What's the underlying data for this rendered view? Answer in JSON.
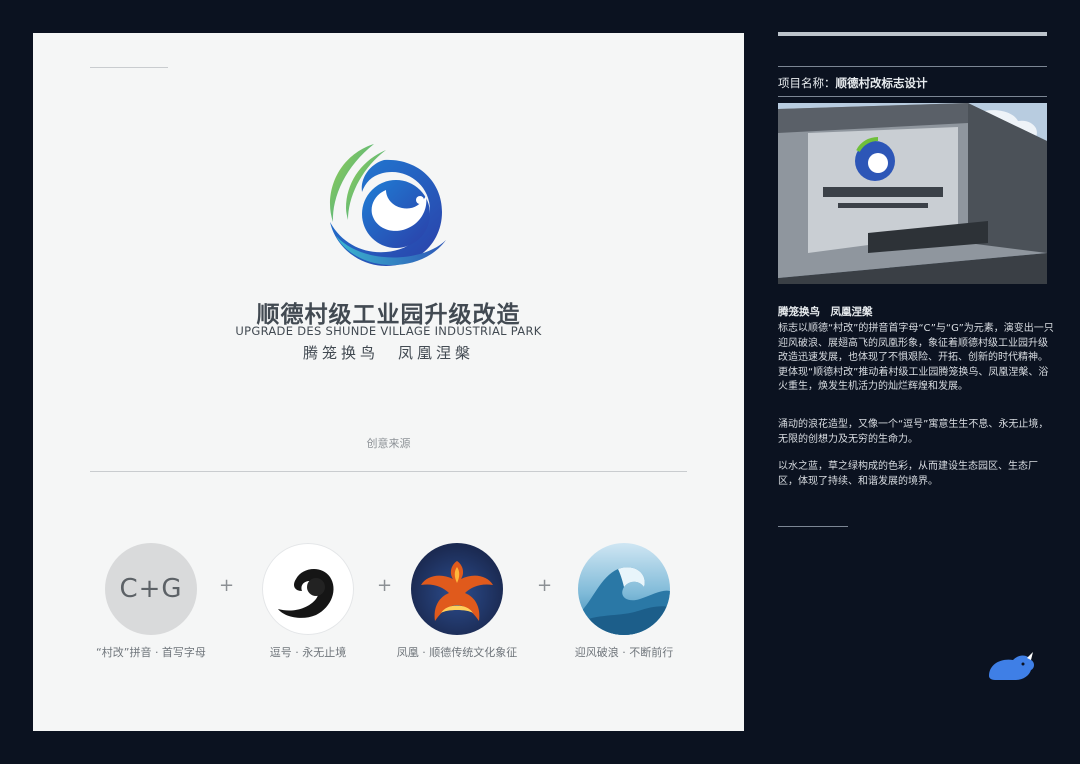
{
  "board": {
    "title": "顺德村级工业园升级改造",
    "subtitle": "UPGRADE DES SHUNDE VILLAGE INDUSTRIAL PARK",
    "slogan": "腾笼换鸟　凤凰涅槃",
    "source_label": "创意来源",
    "elements": [
      {
        "badge": "C+G",
        "caption": "“村改”拼音 · 首写字母"
      },
      {
        "caption": "逗号 · 永无止境"
      },
      {
        "caption": "凤凰 · 顺德传统文化象征"
      },
      {
        "caption": "迎风破浪 · 不断前行"
      }
    ],
    "plus": "+"
  },
  "info": {
    "project_label": "项目名称：",
    "project_name": "顺德村改标志设计",
    "slogan": "腾笼换鸟　凤凰涅槃",
    "paragraphs": [
      "标志以顺德“村改”的拼音首字母“C”与“G”为元素，演变出一只迎风破浪、展翅高飞的凤凰形象，象征着顺德村级工业园升级改造迅速发展，也体现了不惧艰险、开拓、创新的时代精神。更体现“顺德村改”推动着村级工业园腾笼换鸟、凤凰涅槃、浴火重生，焕发生机活力的灿烂辉煌和发展。",
      "涌动的浪花造型，又像一个“逗号”寓意生生不息、永无止境，无限的创想力及无穷的生命力。",
      "以水之蓝，草之绿构成的色彩，从而建设生态园区、生态厂区，体现了持续、和谐发展的境界。"
    ]
  },
  "colors": {
    "background": "#0b1220",
    "board": "#f5f6f6",
    "logo_blue": "#2d56b7",
    "logo_green": "#6fbf3a",
    "logo_cyan": "#28a8c9"
  }
}
